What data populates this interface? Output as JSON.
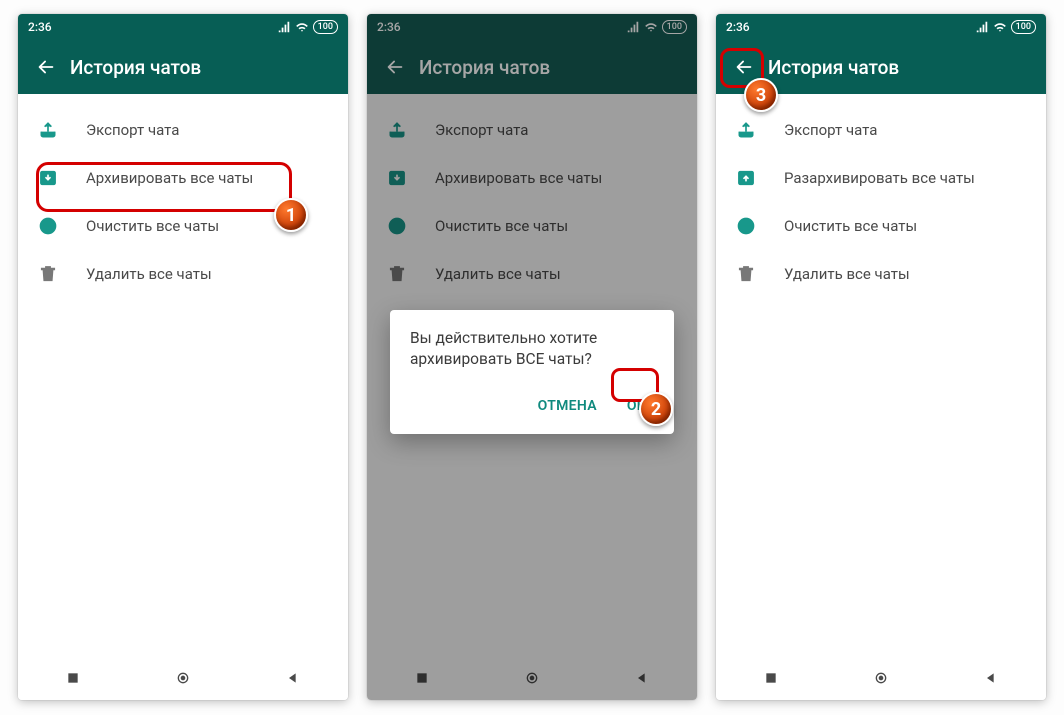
{
  "status": {
    "time": "2:36",
    "battery": "100"
  },
  "toolbar": {
    "title": "История чатов"
  },
  "menu": {
    "export": "Экспорт чата",
    "archive": "Архивировать все чаты",
    "unarchive": "Разархивировать все чаты",
    "clear": "Очистить все чаты",
    "delete": "Удалить все чаты"
  },
  "dialog": {
    "message": "Вы действительно хотите архивировать ВСЕ чаты?",
    "cancel": "ОТМЕНА",
    "ok": "OK"
  },
  "markers": {
    "m1": "1",
    "m2": "2",
    "m3": "3"
  }
}
